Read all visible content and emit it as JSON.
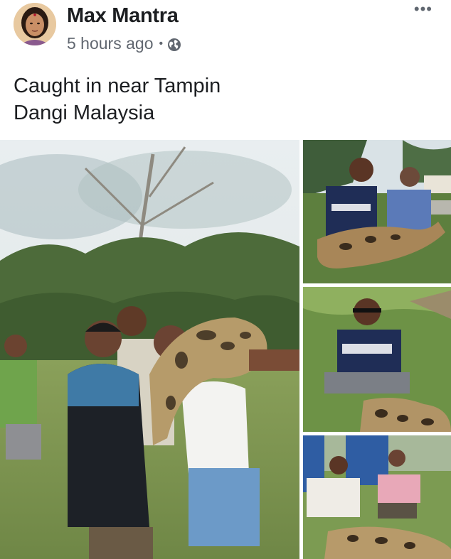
{
  "post": {
    "author": "Max Mantra",
    "timestamp": "5 hours ago",
    "separator": "•",
    "privacy_icon": "globe-icon",
    "more_icon": "more-options-icon",
    "more_label": "•••",
    "text_lines": [
      "Caught in near Tampin",
      "Dangi Malaysia"
    ]
  },
  "photos": [
    "main-photo",
    "photo-top-right",
    "photo-middle-right",
    "photo-bottom-right"
  ],
  "colors": {
    "author": "#1c1e21",
    "meta": "#616770",
    "background": "#ffffff"
  }
}
